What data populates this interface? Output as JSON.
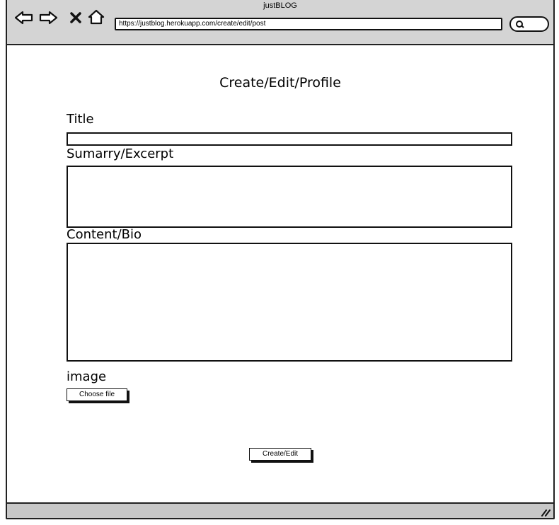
{
  "window": {
    "title": "justBLOG"
  },
  "browser": {
    "url": "https://justblog.herokuapp.com/create/edit/post"
  },
  "page": {
    "heading": "Create/Edit/Profile",
    "title_label": "Title",
    "summary_label": "Sumarry/Excerpt",
    "content_label": "Content/Bio",
    "image_label": "image",
    "choose_file_label": "Choose file",
    "submit_label": "Create/Edit"
  },
  "icons": [
    "back-icon",
    "forward-icon",
    "stop-icon",
    "home-icon",
    "search-icon",
    "resize-handle-icon"
  ]
}
